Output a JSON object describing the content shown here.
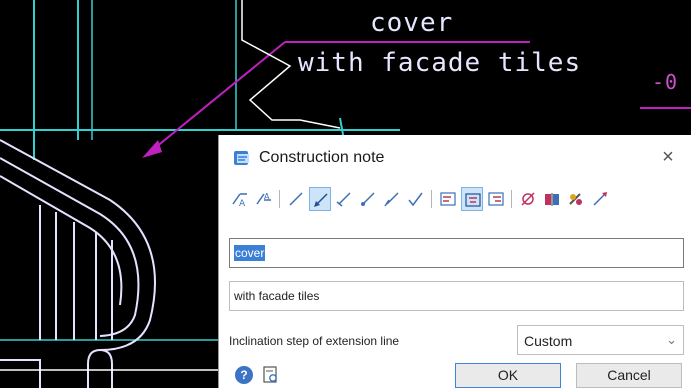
{
  "cad": {
    "text_line1": "cover",
    "text_line2": "with facade tiles",
    "level_mark": "-0"
  },
  "dialog": {
    "title": "Construction note",
    "close_label": "×",
    "toolbar": {
      "buttons": [
        "text-above-line-icon",
        "text-below-line-icon",
        "leader-straight-icon",
        "leader-arrow-icon",
        "leader-tick-icon",
        "leader-dot-icon",
        "leader-slash-icon",
        "leader-plain-icon",
        "align-left-icon",
        "align-center-icon",
        "align-right-icon",
        "no-leader-icon",
        "book-icon",
        "palette-icon",
        "pick-leader-icon"
      ]
    },
    "field_line1": "cover",
    "field_line2": "with facade tiles",
    "inclination_label": "Inclination step of extension line",
    "inclination_value": "Custom",
    "help_label": "?",
    "ok_label": "OK",
    "cancel_label": "Cancel"
  },
  "colors": {
    "cad_background": "#000000",
    "cad_cyan": "#33d0d0",
    "cad_magenta": "#c020c0",
    "cad_white": "#ffffff",
    "accent": "#3b7fd6"
  }
}
